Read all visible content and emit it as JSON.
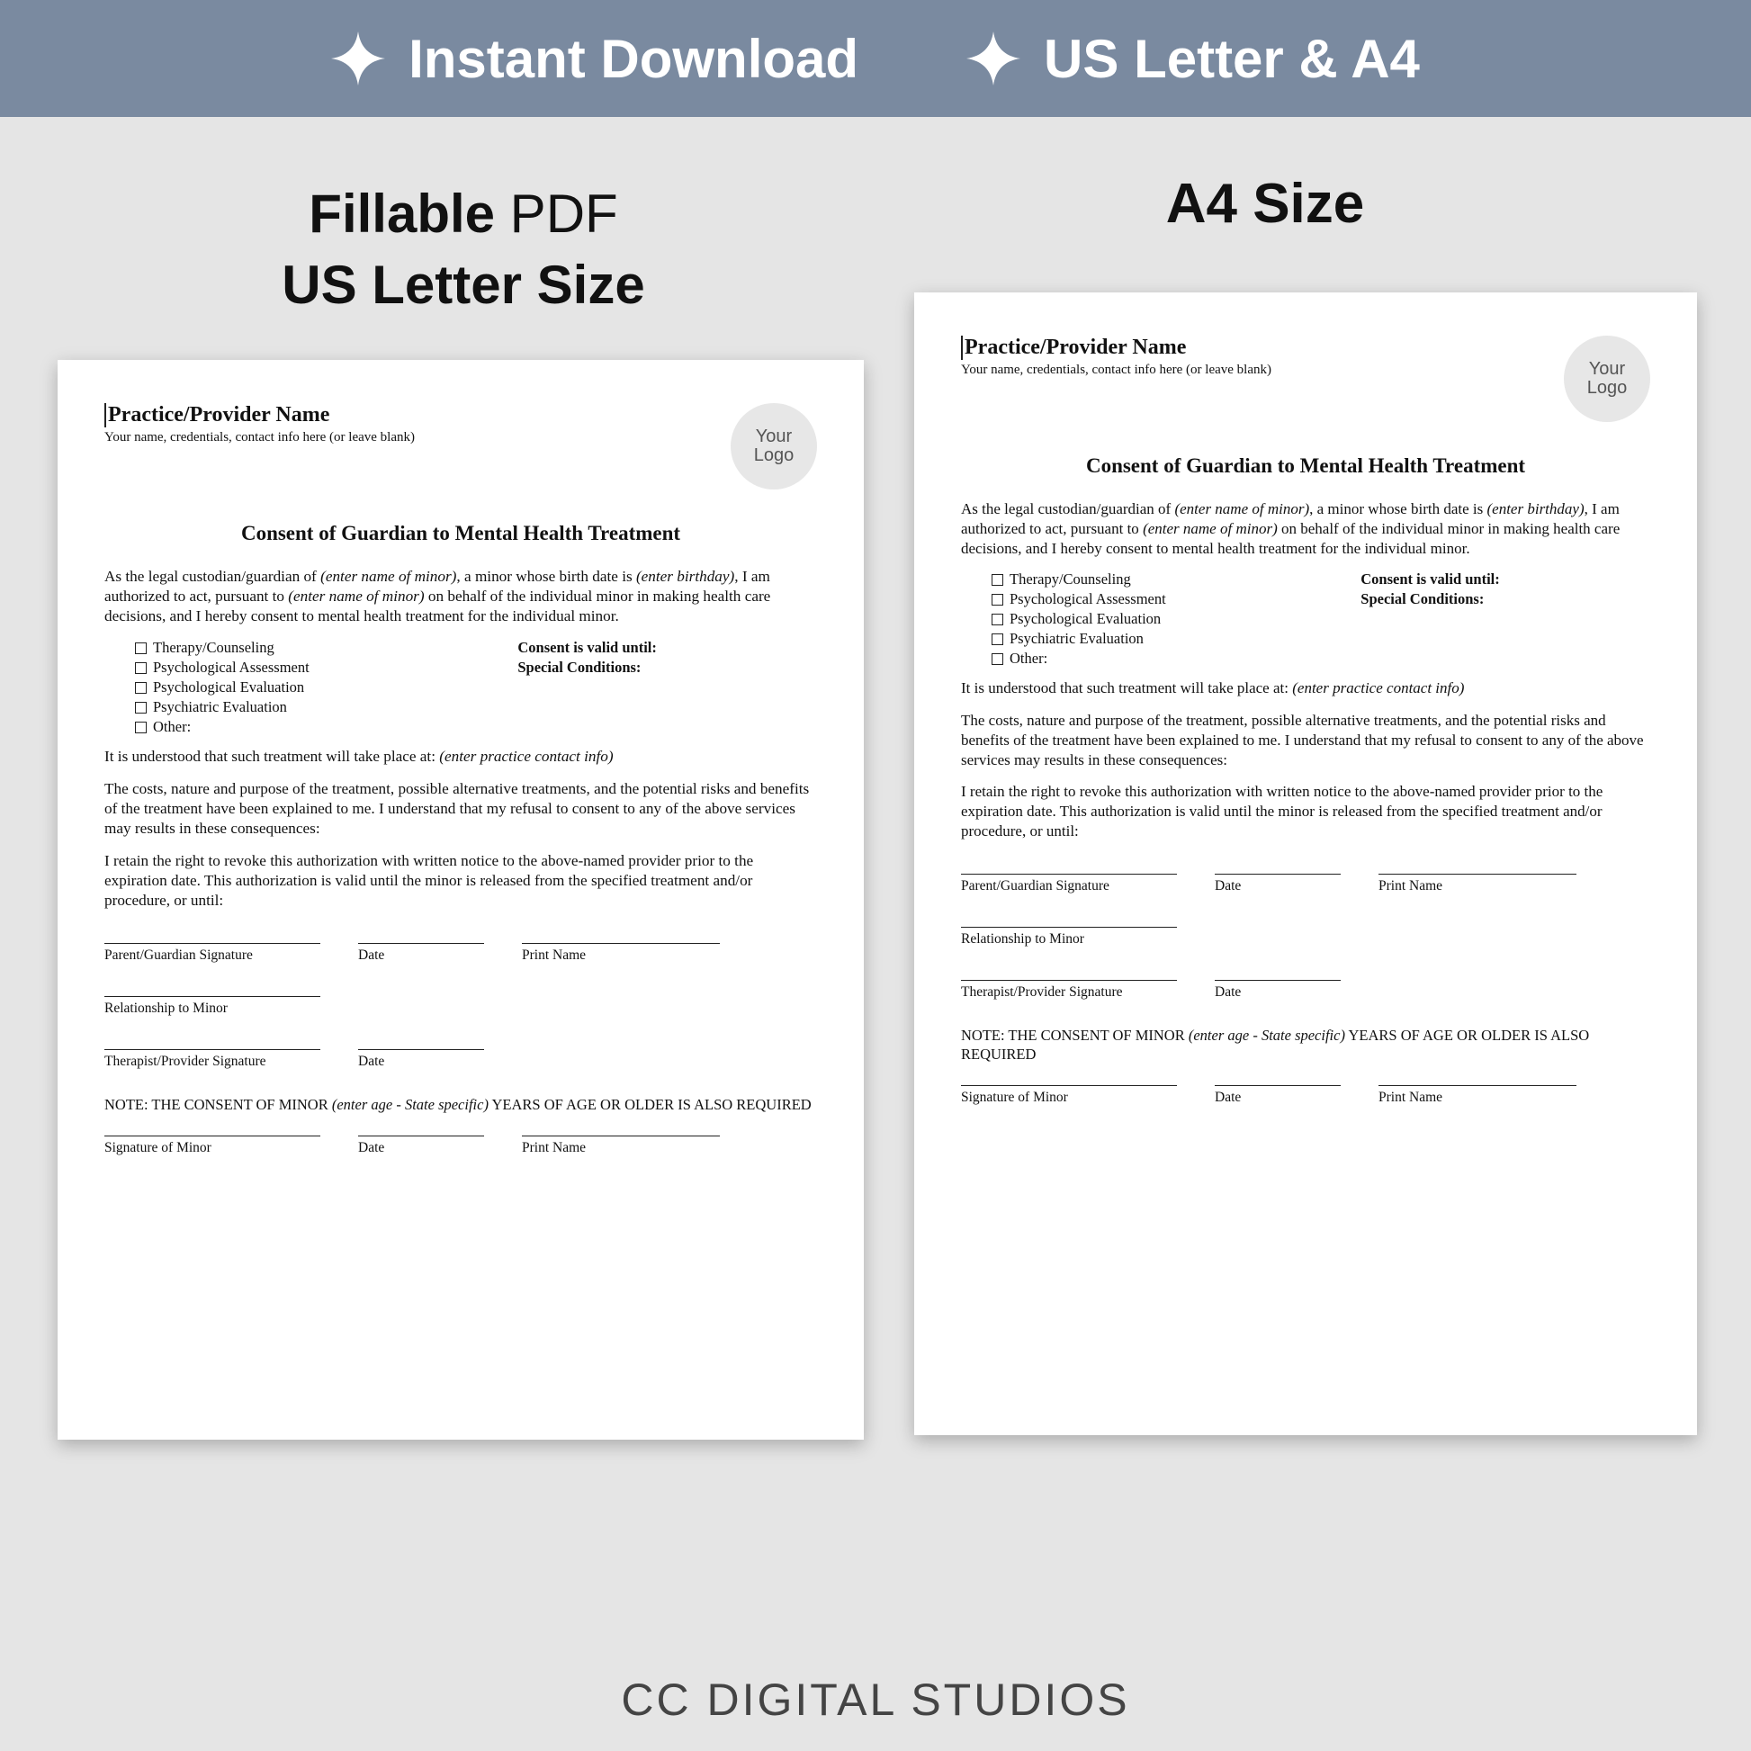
{
  "banner": {
    "item1": "Instant Download",
    "item2": "US Letter & A4"
  },
  "labels": {
    "left_bold": "Fillable",
    "left_reg": " PDF",
    "left_line2": "US Letter Size",
    "right": "A4 Size"
  },
  "doc": {
    "practice_name": "Practice/Provider Name",
    "practice_sub": "Your name, credentials, contact info here (or leave blank)",
    "logo_line1": "Your",
    "logo_line2": "Logo",
    "title": "Consent of Guardian to Mental Health Treatment",
    "intro_1": "As the legal custodian/guardian of ",
    "intro_ph1": "(enter name of minor)",
    "intro_2": ", a minor whose birth date is ",
    "intro_ph2": "(enter birthday)",
    "intro_3": ", I am authorized to act, pursuant to ",
    "intro_ph3": "(enter name of minor)",
    "intro_4": " on behalf of the individual  minor in making health care decisions, and I hereby consent to mental health treatment for the individual minor.",
    "checks": [
      "Therapy/Counseling",
      "Psychological Assessment",
      "Psychological Evaluation",
      "Psychiatric Evaluation",
      "Other:"
    ],
    "consent_valid": "Consent is valid until:",
    "special_cond": "Special Conditions:",
    "place_1": "It is understood that such treatment will take place at: ",
    "place_ph": "(enter practice contact info)",
    "para_costs": "The costs, nature and purpose of the treatment, possible alternative treatments, and the potential risks and benefits of the treatment have been explained to me.  I understand that my refusal to consent to any of the above services may results in these consequences:",
    "para_revoke": "I retain the right to revoke this authorization with written notice to the above-named provider prior to the expiration date.  This authorization is valid until the minor is released from the specified treatment and/or procedure, or until:",
    "sig_parent": "Parent/Guardian Signature",
    "sig_date": "Date",
    "sig_print": "Print Name",
    "sig_relation": "Relationship to Minor",
    "sig_therapist": "Therapist/Provider Signature",
    "note_1": "NOTE:  THE CONSENT OF MINOR ",
    "note_ph": "(enter age - State specific)",
    "note_2": " YEARS OF AGE OR OLDER IS ALSO REQUIRED",
    "sig_minor": "Signature of Minor"
  },
  "footer": "CC DIGITAL STUDIOS"
}
